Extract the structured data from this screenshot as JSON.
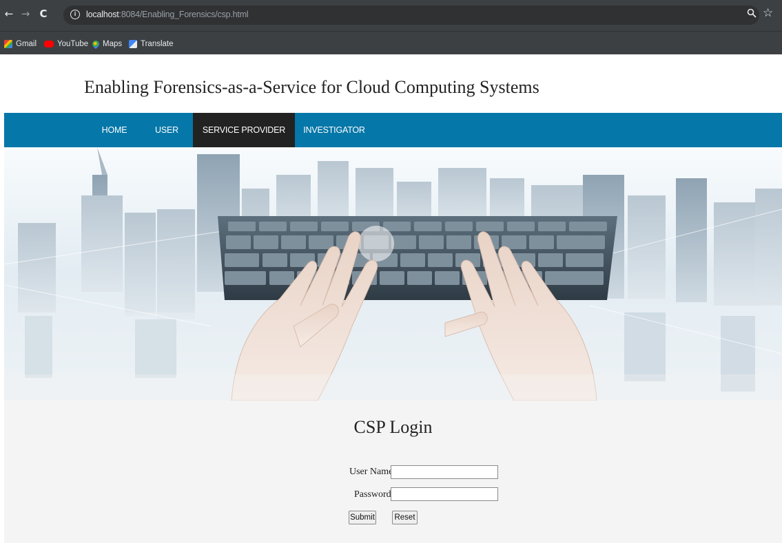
{
  "browser": {
    "url_host": "localhost",
    "url_path": ":8084/Enabling_Forensics/csp.html",
    "bookmarks": [
      {
        "label": "Gmail",
        "icon": "gmail-icon"
      },
      {
        "label": "YouTube",
        "icon": "youtube-icon"
      },
      {
        "label": "Maps",
        "icon": "maps-icon"
      },
      {
        "label": "Translate",
        "icon": "translate-icon"
      }
    ]
  },
  "site": {
    "title": "Enabling Forensics-as-a-Service for Cloud Computing Systems",
    "menu": [
      {
        "label": "HOME"
      },
      {
        "label": "USER"
      },
      {
        "label": "SERVICE PROVIDER",
        "active": true
      },
      {
        "label": "INVESTIGATOR"
      }
    ],
    "accent_color": "#0577a8",
    "active_menu_color": "#222222"
  },
  "login": {
    "title": "CSP Login",
    "username_label": "User Name:",
    "username_value": "",
    "password_label": "Password:",
    "password_value": "",
    "submit_label": "Submit",
    "reset_label": "Reset"
  }
}
